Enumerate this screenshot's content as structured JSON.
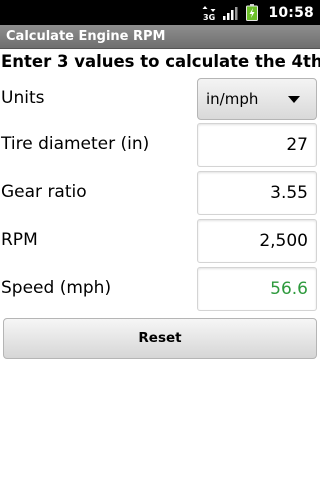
{
  "status_bar": {
    "time": "10:58",
    "icons": [
      "data-transfer-icon",
      "signal-icon",
      "battery-charging-icon"
    ]
  },
  "app": {
    "title": "Calculate Engine RPM"
  },
  "main": {
    "headline": "Enter 3 values to calculate the 4th",
    "units": {
      "label": "Units",
      "selected": "in/mph"
    },
    "tire_diameter": {
      "label": "Tire diameter (in)",
      "value": "27"
    },
    "gear_ratio": {
      "label": "Gear ratio",
      "value": "3.55"
    },
    "rpm": {
      "label": "RPM",
      "value": "2,500"
    },
    "speed": {
      "label": "Speed (mph)",
      "value": "56.6"
    },
    "reset_label": "Reset"
  },
  "colors": {
    "result_text": "#2e9a3d",
    "title_bar": "#7c7c7c"
  }
}
